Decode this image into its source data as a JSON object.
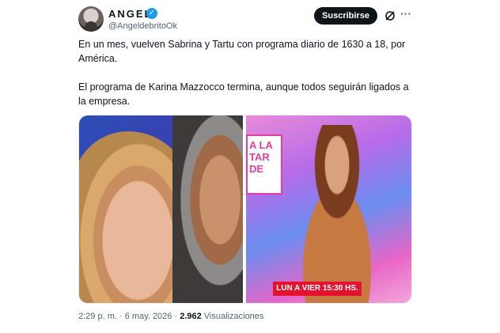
{
  "author": {
    "name": "ANGEL",
    "handle": "@AngeldebritoOk"
  },
  "header": {
    "subscribe_label": "Suscribirse",
    "more_label": "···"
  },
  "tweet": {
    "paragraphs": [
      "En un mes, vuelven Sabrina y Tartu con programa diario de 1630 a 18, por América.",
      "El programa de Karina Mazzocco termina, aunque todos seguirán ligados a la empresa."
    ]
  },
  "media": {
    "right_sign": "A LA TAR DE",
    "right_banner": "LUN A VIER 15:30 HS."
  },
  "meta": {
    "time": "2:29 p. m. · 6 may. 2026 ·",
    "views": "2.962",
    "views_label": "Visualizaciones"
  },
  "colors": {
    "verified": "#1d9bf0",
    "subscribe_bg": "#0f1419",
    "banner": "#e4122f"
  },
  "icons": [
    "verified-icon",
    "grok-icon",
    "more-icon"
  ]
}
